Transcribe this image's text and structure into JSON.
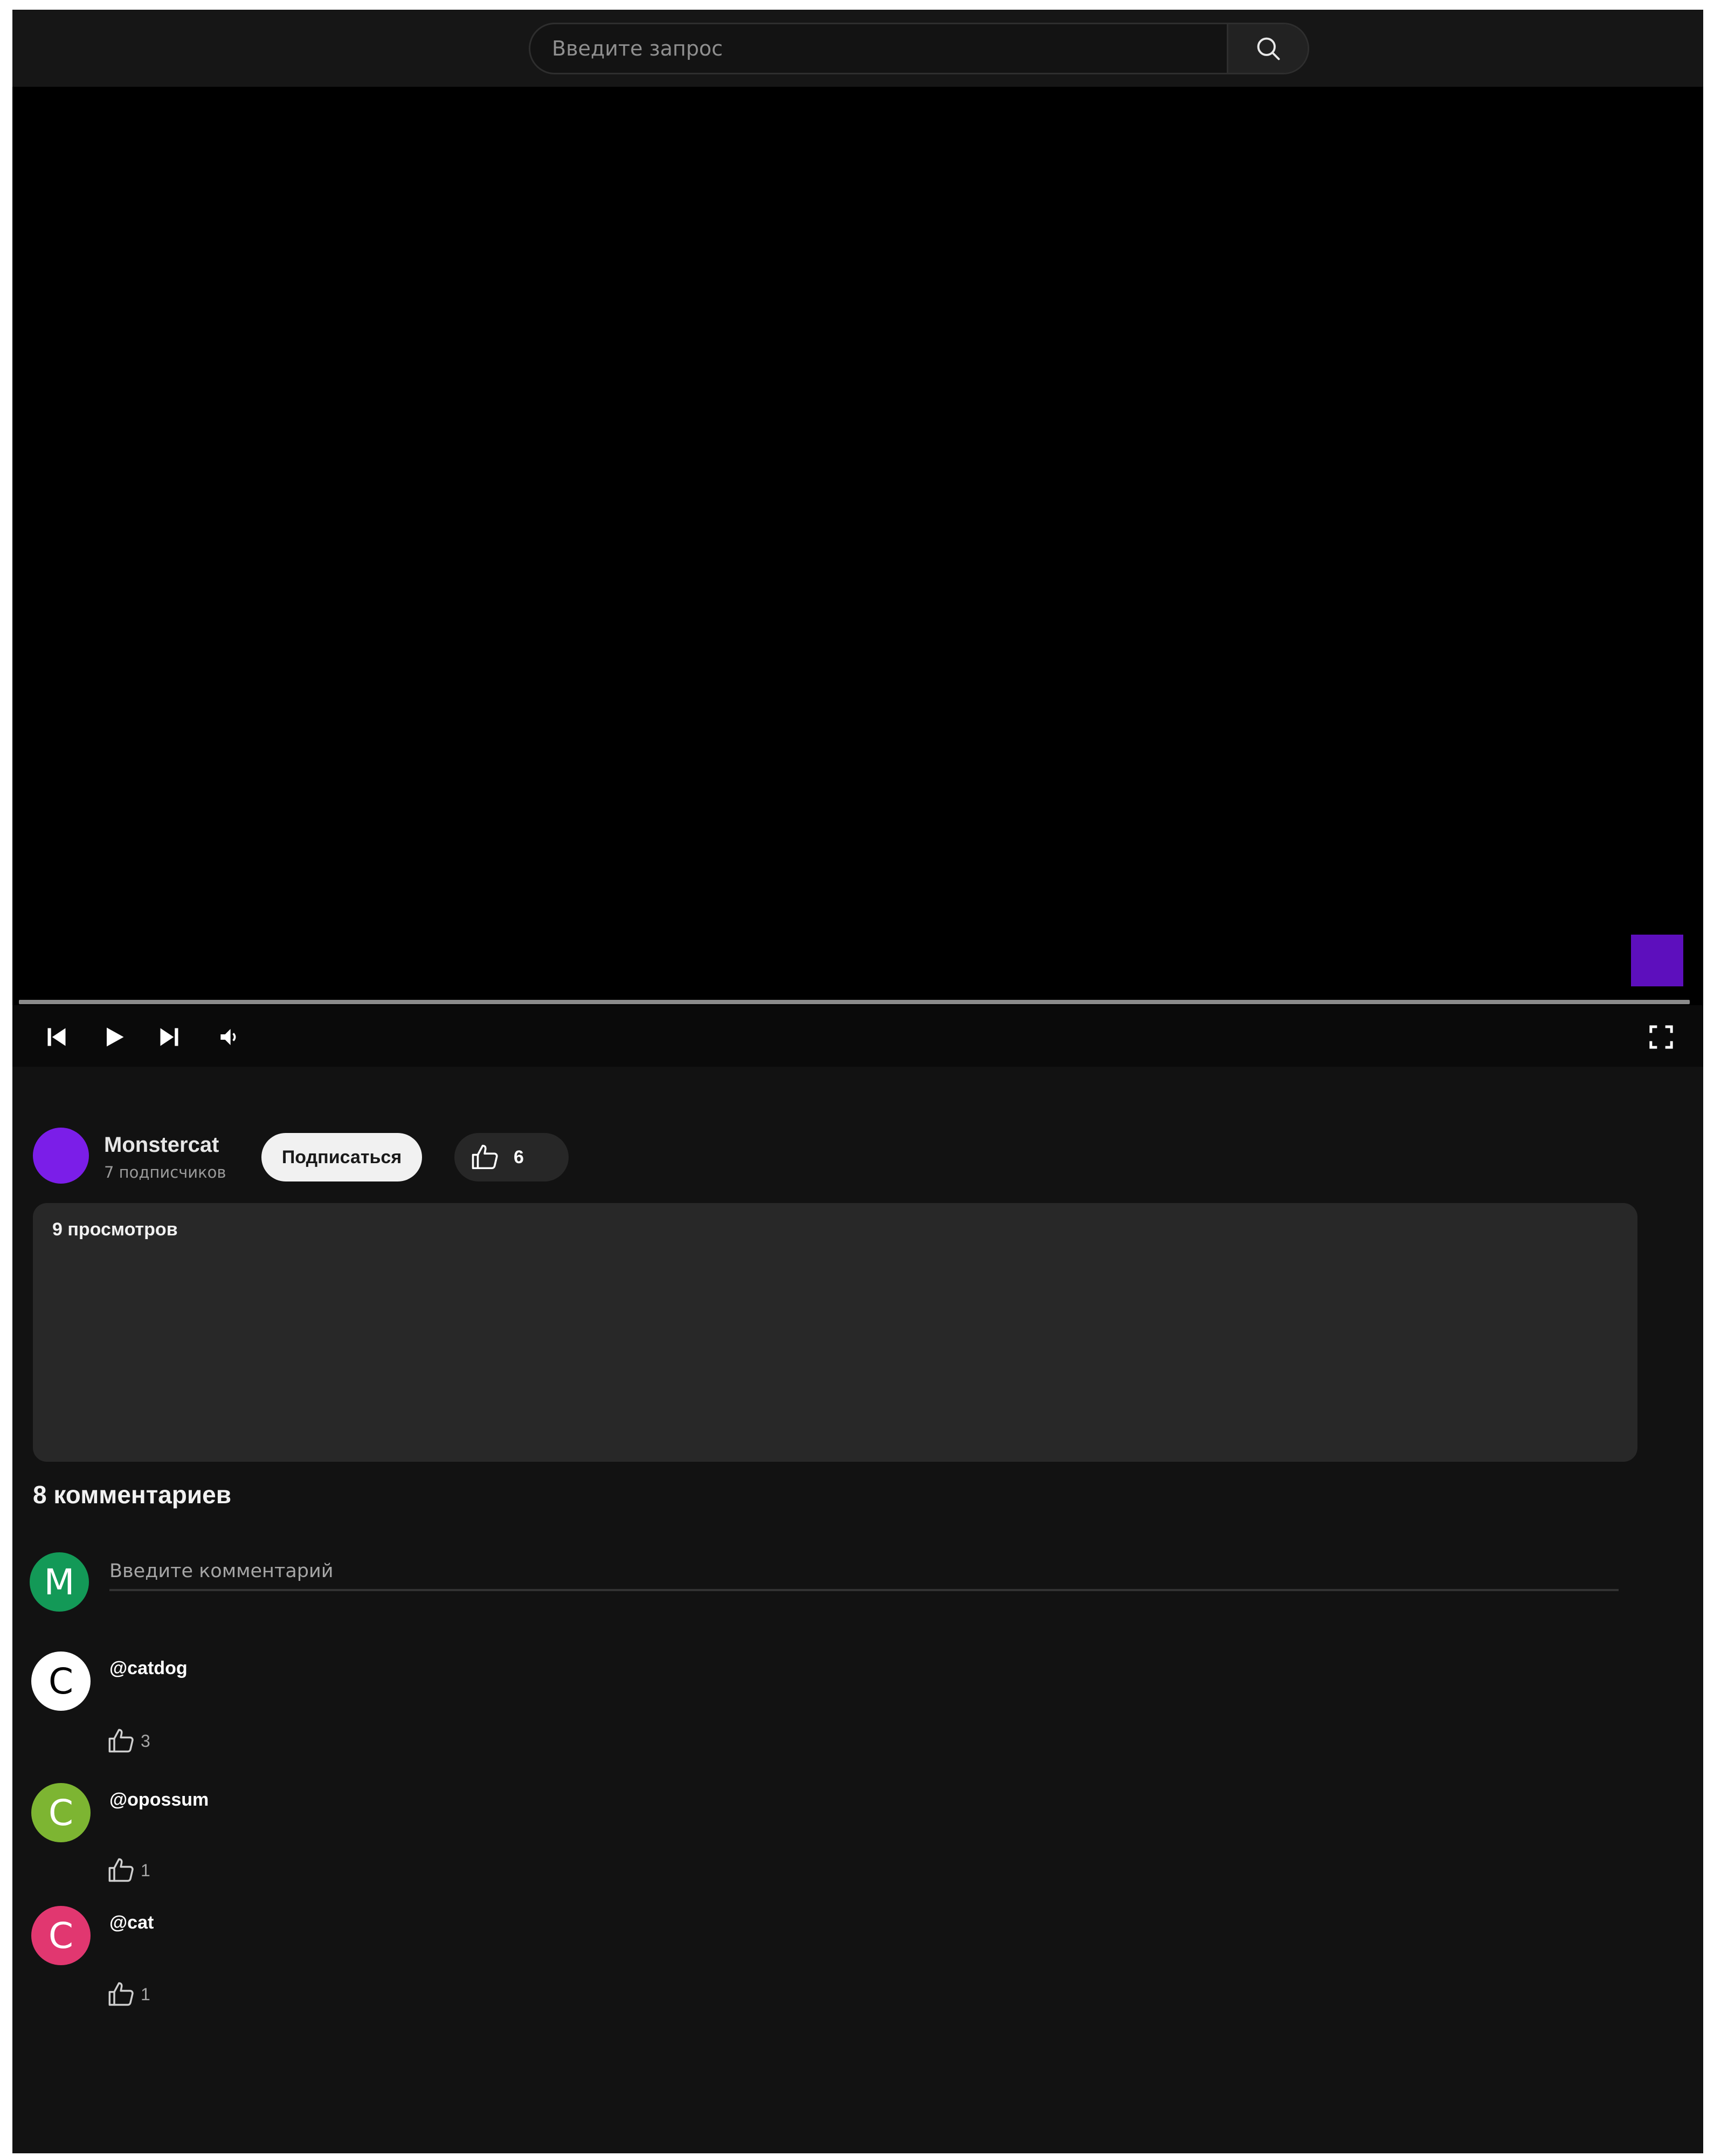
{
  "header": {
    "search_placeholder": "Введите запрос",
    "search_icon": "search-icon"
  },
  "player": {
    "controls": [
      "skip-previous-icon",
      "play-icon",
      "skip-next-icon",
      "volume-icon",
      "fullscreen-icon"
    ],
    "accent_color": "#5d0fbd"
  },
  "channel": {
    "name": "Monstercat",
    "subscribers": "7 подписчиков",
    "subscribe_label": "Подписаться",
    "likes": "6",
    "avatar_color": "#7b1ee8"
  },
  "description": {
    "views": "9 просмотров"
  },
  "comments": {
    "title": "8 комментариев",
    "input_placeholder": "Введите комментарий",
    "current_user": {
      "initial": "M",
      "color": "#139957"
    },
    "items": [
      {
        "initial": "C",
        "author": "@catdog",
        "likes": "3",
        "color": "#ffffff",
        "text_color": "#000000"
      },
      {
        "initial": "C",
        "author": "@opossum",
        "likes": "1",
        "color": "#7db532",
        "text_color": "#ffffff"
      },
      {
        "initial": "C",
        "author": "@cat",
        "likes": "1",
        "color": "#e13770",
        "text_color": "#ffffff"
      }
    ]
  }
}
